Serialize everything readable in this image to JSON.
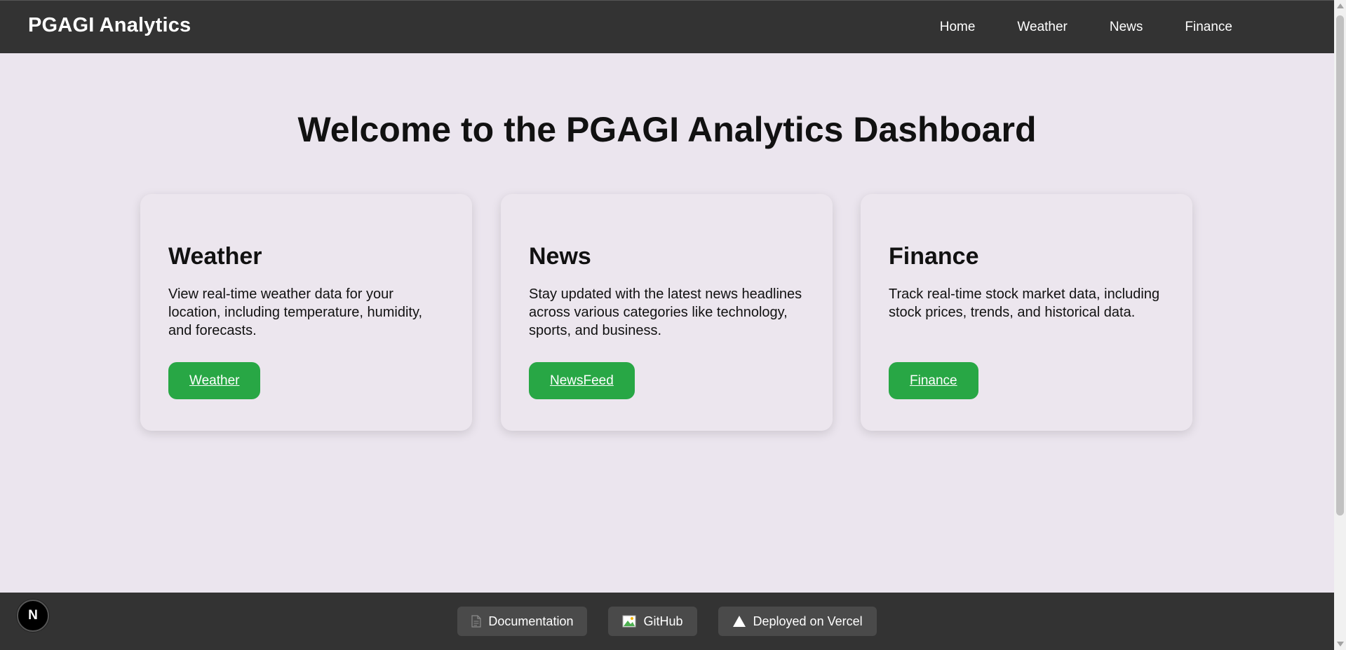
{
  "navbar": {
    "brand": "PGAGI Analytics",
    "links": [
      "Home",
      "Weather",
      "News",
      "Finance"
    ]
  },
  "main": {
    "title": "Welcome to the PGAGI Analytics Dashboard",
    "cards": [
      {
        "title": "Weather",
        "description": "View real-time weather data for your location, including temperature, humidity, and forecasts.",
        "button": "Weather"
      },
      {
        "title": "News",
        "description": "Stay updated with the latest news headlines across various categories like technology, sports, and business.",
        "button": "NewsFeed"
      },
      {
        "title": "Finance",
        "description": "Track real-time stock market data, including stock prices, trends, and historical data.",
        "button": "Finance"
      }
    ]
  },
  "footer": {
    "links": [
      {
        "label": "Documentation",
        "icon": "document-icon"
      },
      {
        "label": "GitHub",
        "icon": "broken-image-icon"
      },
      {
        "label": "Deployed on Vercel",
        "icon": "vercel-triangle-icon"
      }
    ]
  },
  "badge": {
    "label": "N",
    "icon": "nextjs-icon"
  },
  "colors": {
    "navbar_bg": "#333333",
    "page_bg": "#ebe5ee",
    "button_green": "#28a745",
    "footer_bg": "#333333"
  }
}
